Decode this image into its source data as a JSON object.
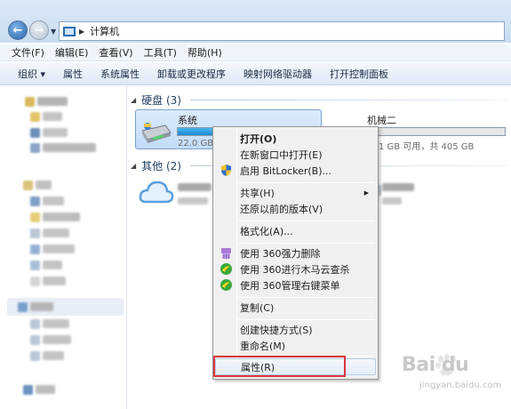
{
  "address_bar": {
    "path": "计算机"
  },
  "menu": [
    "文件(F)",
    "编辑(E)",
    "查看(V)",
    "工具(T)",
    "帮助(H)"
  ],
  "command_bar": {
    "organize": "组织 ▾",
    "items": [
      "属性",
      "系统属性",
      "卸载或更改程序",
      "映射网络驱动器",
      "打开控制面板"
    ]
  },
  "sections": {
    "hard_disks": "硬盘 (3)",
    "other": "其他 (2)"
  },
  "drives": [
    {
      "name": "系统",
      "stat": "22.0 GB",
      "usage_fraction": 0.55
    },
    {
      "name": "机械二",
      "stat": "1 GB 可用，共 405 GB",
      "usage_fraction": 0.04
    }
  ],
  "context_menu": {
    "open": "打开(O)",
    "open_new_window": "在新窗口中打开(E)",
    "bitlocker": "启用 BitLocker(B)...",
    "share": "共享(H)",
    "restore": "还原以前的版本(V)",
    "format": "格式化(A)...",
    "del360": "使用 360强力删除",
    "scan360": "使用 360进行木马云查杀",
    "manage360": "使用 360管理右键菜单",
    "copy": "复制(C)",
    "shortcut": "创建快捷方式(S)",
    "rename": "重命名(M)",
    "properties": "属性(R)"
  },
  "watermark": {
    "logo": "Bai du",
    "sub": "jingyan.baidu.com"
  },
  "colors": {
    "accent": "#1c8ad1",
    "highlight": "#d9363e",
    "selection": "#c1dbf8"
  }
}
